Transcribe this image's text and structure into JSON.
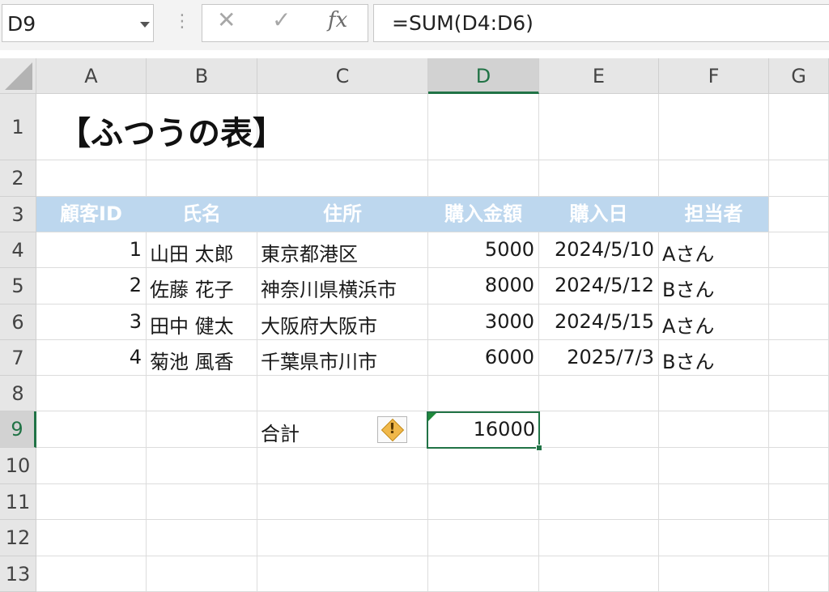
{
  "formula_bar": {
    "name_box": "D9",
    "separator": "⋮",
    "cancel_glyph": "✕",
    "enter_glyph": "✓",
    "function_label": "fx",
    "formula": "=SUM(D4:D6)"
  },
  "columns": [
    "A",
    "B",
    "C",
    "D",
    "E",
    "F",
    "G"
  ],
  "rows": [
    "1",
    "2",
    "3",
    "4",
    "5",
    "6",
    "7",
    "8",
    "9",
    "10",
    "11",
    "12",
    "13"
  ],
  "selected": {
    "column": "D",
    "row": "9"
  },
  "sheet": {
    "title": "【ふつうの表】",
    "headers": [
      "顧客ID",
      "氏名",
      "住所",
      "購入金額",
      "購入日",
      "担当者"
    ],
    "records": [
      {
        "id": "1",
        "name": "山田 太郎",
        "address": "東京都港区",
        "amount": "5000",
        "date": "2024/5/10",
        "staff": "Aさん"
      },
      {
        "id": "2",
        "name": "佐藤 花子",
        "address": "神奈川県横浜市",
        "amount": "8000",
        "date": "2024/5/12",
        "staff": "Bさん"
      },
      {
        "id": "3",
        "name": "田中 健太",
        "address": "大阪府大阪市",
        "amount": "3000",
        "date": "2024/5/15",
        "staff": "Aさん"
      },
      {
        "id": "4",
        "name": "菊池 風香",
        "address": "千葉県市川市",
        "amount": "6000",
        "date": "2025/7/3",
        "staff": "Bさん"
      }
    ],
    "total_label": "合計",
    "total_value": "16000",
    "warning_mark": "!"
  },
  "colors": {
    "header_fill": "#bdd7ee",
    "selection_green": "#217346",
    "warning": "#f0b84a"
  },
  "icons": {
    "name_box_dropdown": "chevron-down-icon",
    "cancel": "close-icon",
    "enter": "check-icon",
    "error_warning": "warning-diamond-icon"
  }
}
